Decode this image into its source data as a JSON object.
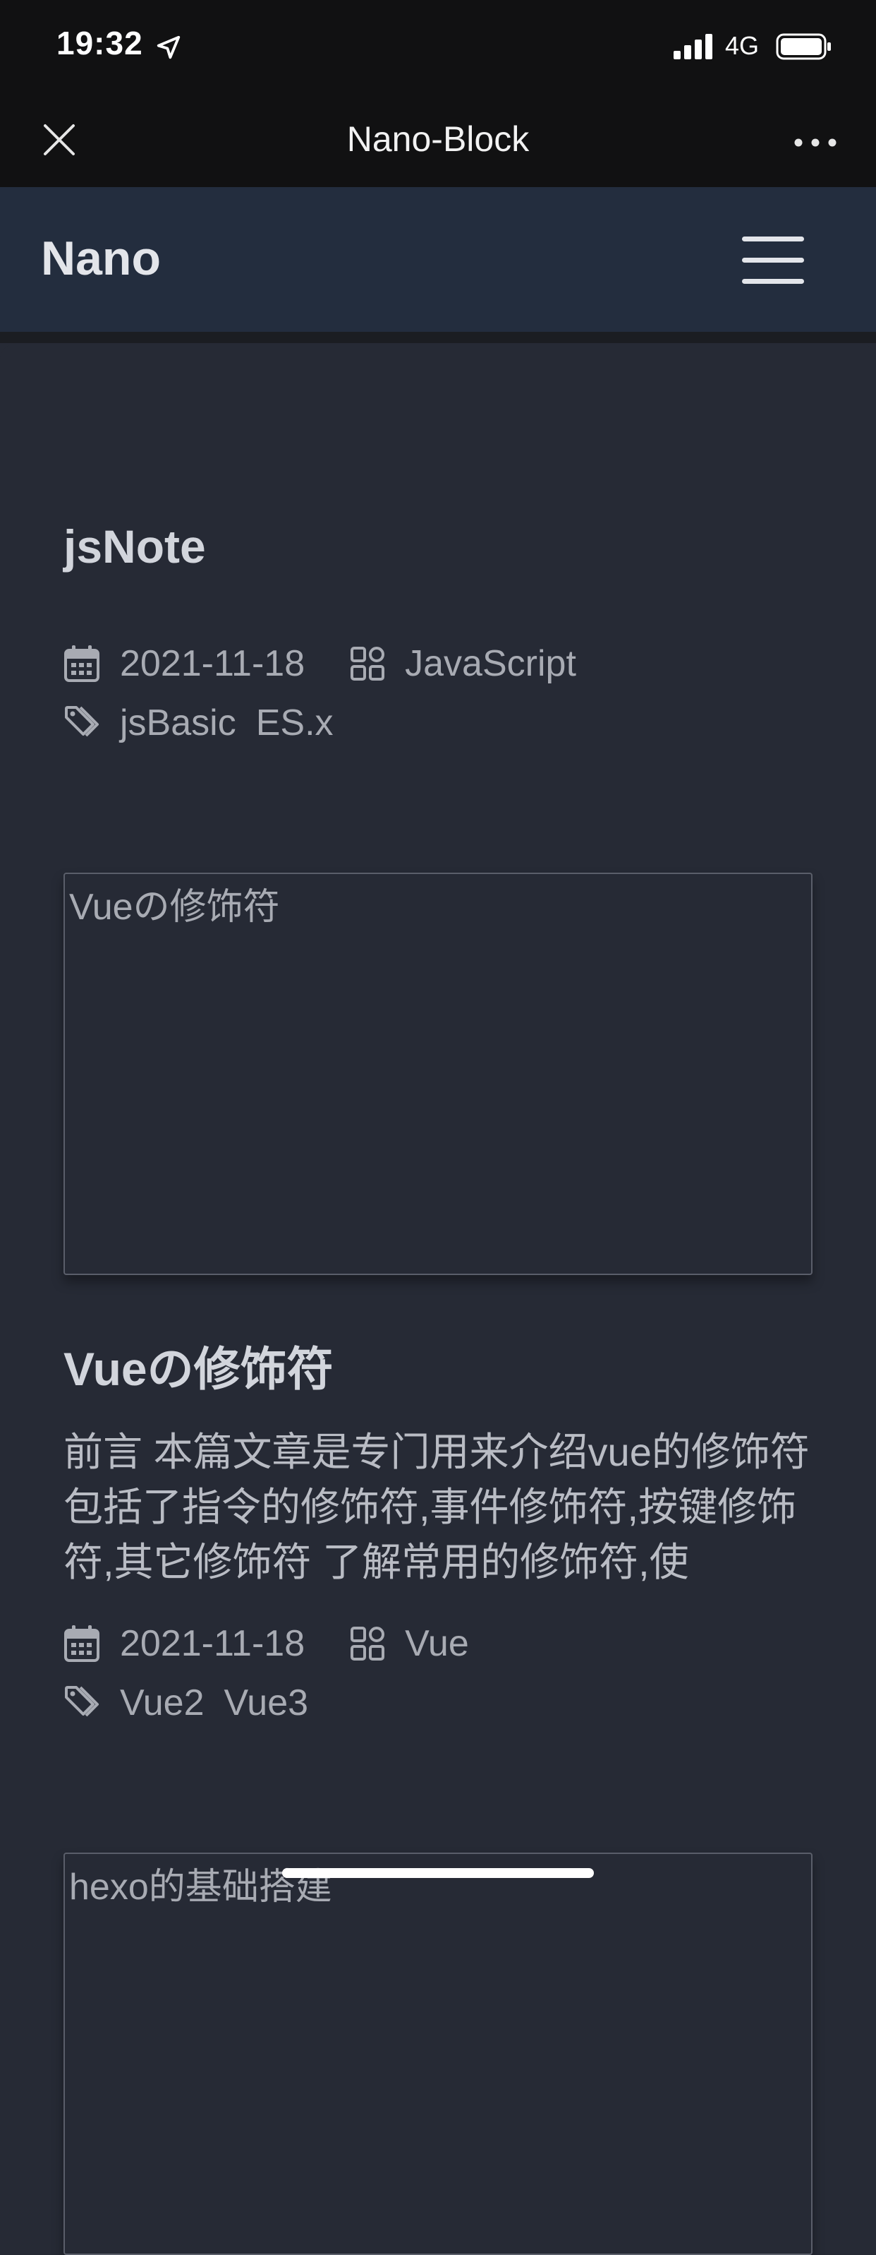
{
  "status_bar": {
    "time": "19:32",
    "network": "4G",
    "icons": [
      "location-arrow-icon",
      "cellular-signal-icon",
      "battery-icon"
    ]
  },
  "title_bar": {
    "title": "Nano-Block",
    "icons": [
      "close-icon",
      "more-icon"
    ]
  },
  "navbar": {
    "brand": "Nano",
    "menu_icon": "hamburger-menu-icon"
  },
  "posts": [
    {
      "title": "jsNote",
      "date": "2021-11-18",
      "category": "JavaScript",
      "tags": [
        "jsBasic",
        "ES.x"
      ]
    },
    {
      "cover_alt": "Vueの修饰符",
      "title": "Vueの修饰符",
      "excerpt": "前言 本篇文章是专门用来介绍vue的修饰符 包括了指令的修饰符,事件修饰符,按键修饰符,其它修饰符 了解常用的修饰符,使",
      "date": "2021-11-18",
      "category": "Vue",
      "tags": [
        "Vue2",
        "Vue3"
      ]
    },
    {
      "cover_alt": "hexo的基础搭建"
    }
  ],
  "colors": {
    "status_bar_bg": "#111112",
    "navbar_bg": "#232d3e",
    "content_bg": "#262a35",
    "title_text": "#d2d5dc",
    "meta_text": "#a8abb3"
  }
}
